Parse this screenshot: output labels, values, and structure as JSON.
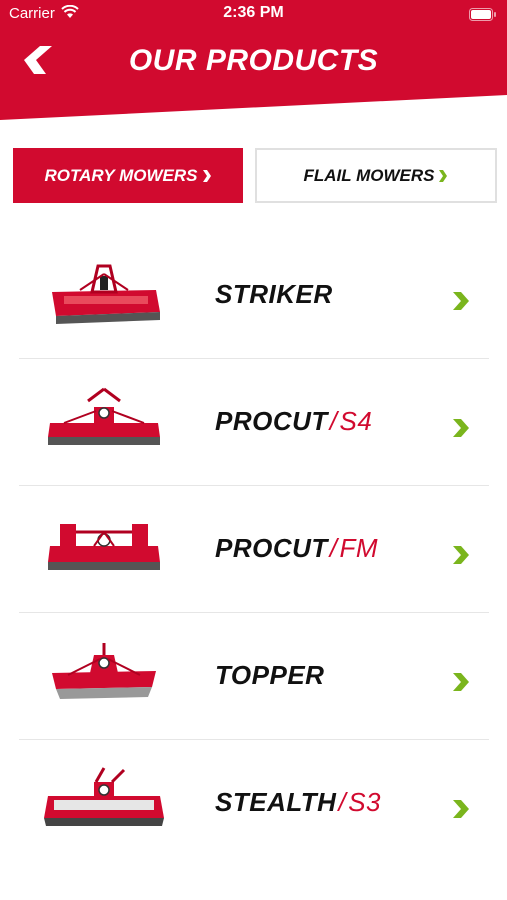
{
  "status_bar": {
    "carrier": "Carrier",
    "time": "2:36 PM"
  },
  "header": {
    "title": "OUR PRODUCTS",
    "brand_color": "#d10a2f"
  },
  "tabs": [
    {
      "label": "ROTARY MOWERS",
      "active": true
    },
    {
      "label": "FLAIL MOWERS",
      "active": false
    }
  ],
  "products": [
    {
      "name": "STRIKER",
      "sub": ""
    },
    {
      "name": "PROCUT",
      "sub": "S4"
    },
    {
      "name": "PROCUT",
      "sub": "FM"
    },
    {
      "name": "TOPPER",
      "sub": ""
    },
    {
      "name": "STEALTH",
      "sub": "S3"
    }
  ],
  "colors": {
    "accent_green": "#7ab51d",
    "red": "#d10a2f"
  },
  "icons": {
    "back": "back-arrow-icon",
    "chevron": "chevron-right-icon"
  }
}
